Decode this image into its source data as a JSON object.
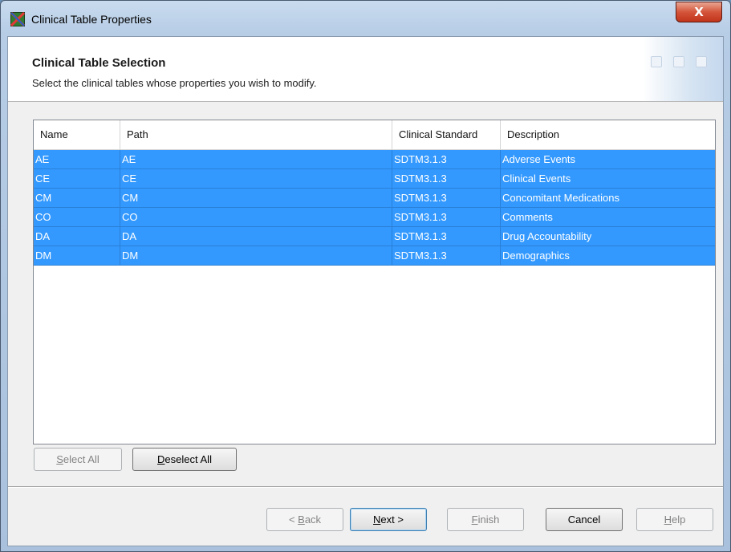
{
  "window": {
    "title": "Clinical Table Properties",
    "close_label": "X"
  },
  "header": {
    "title": "Clinical Table Selection",
    "subtitle": "Select the clinical tables whose properties you wish to modify."
  },
  "table": {
    "columns": [
      "Name",
      "Path",
      "Clinical Standard",
      "Description"
    ],
    "rows": [
      [
        "AE",
        "AE",
        "SDTM3.1.3",
        "Adverse Events"
      ],
      [
        "CE",
        "CE",
        "SDTM3.1.3",
        "Clinical Events"
      ],
      [
        "CM",
        "CM",
        "SDTM3.1.3",
        "Concomitant Medications"
      ],
      [
        "CO",
        "CO",
        "SDTM3.1.3",
        "Comments"
      ],
      [
        "DA",
        "DA",
        "SDTM3.1.3",
        "Drug Accountability"
      ],
      [
        "DM",
        "DM",
        "SDTM3.1.3",
        "Demographics"
      ]
    ]
  },
  "buttons": {
    "select_all": {
      "mnemonic": "S",
      "rest": "elect All"
    },
    "deselect_all": {
      "mnemonic": "D",
      "rest": "eselect All"
    },
    "back": {
      "prefix": "< ",
      "mnemonic": "B",
      "rest": "ack"
    },
    "next": {
      "mnemonic": "N",
      "rest": "ext >"
    },
    "finish": {
      "mnemonic": "F",
      "rest": "inish"
    },
    "cancel": {
      "label": "Cancel"
    },
    "help": {
      "mnemonic": "H",
      "rest": "elp"
    }
  },
  "colors": {
    "selection": "#3399ff",
    "selection_text": "#ffffff"
  },
  "icons": {
    "app": "clinical-table-icon"
  }
}
